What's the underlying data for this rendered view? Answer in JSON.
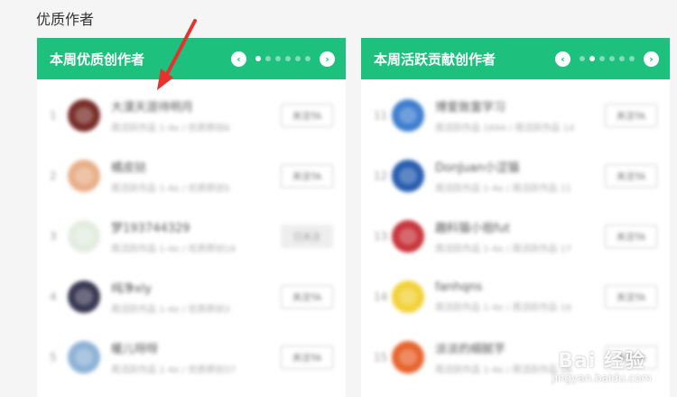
{
  "page": {
    "section_title": "优质作者"
  },
  "left_panel": {
    "title": "本周优质创作者",
    "prev": "‹",
    "next": "›",
    "dots": 6,
    "rows": [
      {
        "rank": "1",
        "name": "大漠天涯待明月",
        "meta": "周活跃作品 1-4e / 优质原创6",
        "follow": "关注TA",
        "followed": false,
        "avatar_color": "#7a2f2a"
      },
      {
        "rank": "2",
        "name": "橘皮挞",
        "meta": "周活跃作品 1-4e / 优质原创5",
        "follow": "关注TA",
        "followed": false,
        "avatar_color": "#e8b08a"
      },
      {
        "rank": "3",
        "name": "梦193744329",
        "meta": "周活跃作品 1-4e / 优质原创18",
        "follow": "已关注",
        "followed": true,
        "avatar_color": "#e4ece0"
      },
      {
        "rank": "4",
        "name": "纯净xly",
        "meta": "周活跃作品 1-4e / 优质原创3",
        "follow": "关注TA",
        "followed": false,
        "avatar_color": "#3b3a55"
      },
      {
        "rank": "5",
        "name": "暖儿呀呀",
        "meta": "周活跃作品 1-4e / 优质原创37",
        "follow": "关注TA",
        "followed": false,
        "avatar_color": "#8fb3d6"
      }
    ]
  },
  "right_panel": {
    "title": "本周活跃贡献创作者",
    "prev": "‹",
    "next": "›",
    "dots": 6,
    "rows": [
      {
        "rank": "11",
        "name": "博爱致富学习",
        "meta": "周活跃作品 1694 / 周活跃作品 14",
        "follow": "关注TA",
        "followed": false,
        "avatar_color": "#3f7fd0"
      },
      {
        "rank": "12",
        "name": "DonJuan小涩猫",
        "meta": "周活跃作品 1-4e / 周活跃作品 11",
        "follow": "关注TA",
        "followed": false,
        "avatar_color": "#2a5fb0"
      },
      {
        "rank": "13",
        "name": "趣料猫小祖fut",
        "meta": "周活跃作品 1-4e / 周活跃作品 17",
        "follow": "关注TA",
        "followed": false,
        "avatar_color": "#c8373e"
      },
      {
        "rank": "14",
        "name": "fanhqns",
        "meta": "周活跃作品 1-4e / 周活跃作品 16",
        "follow": "关注TA",
        "followed": false,
        "avatar_color": "#f2d23a"
      },
      {
        "rank": "15",
        "name": "淡淡的细腻芋",
        "meta": "周活跃作品 1-4e / 周活跃作品 16",
        "follow": "关注TA",
        "followed": false,
        "avatar_color": "#e8652f"
      }
    ]
  },
  "watermark": {
    "main": "Bai 经验",
    "sub": "jingyan.baidu.com"
  },
  "colors": {
    "accent": "#1dc07d",
    "annotation_arrow": "#e5322d"
  }
}
